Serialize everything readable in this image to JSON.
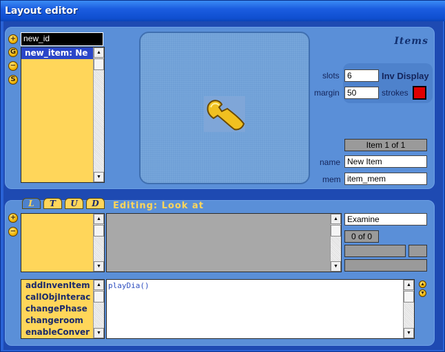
{
  "window": {
    "title": "Layout editor"
  },
  "top_panel": {
    "id_field": "new_id",
    "object_list": [
      "new_item: Ne"
    ],
    "side_buttons": [
      {
        "icon": "plus-icon",
        "glyph": "+"
      },
      {
        "icon": "globe-icon",
        "glyph": "G"
      },
      {
        "icon": "minus-icon",
        "glyph": "−"
      },
      {
        "icon": "s-icon",
        "glyph": "S"
      }
    ],
    "section_title": "Items",
    "slots_label": "slots",
    "slots_value": "6",
    "margin_label": "margin",
    "margin_value": "50",
    "inv_display_label": "Inv Display",
    "strokes_label": "strokes",
    "strokes_color": "#e00000",
    "item_counter": "Item 1 of 1",
    "name_label": "name",
    "name_value": "New Item",
    "mem_label": "mem",
    "mem_value": "item_mem"
  },
  "bottom_panel": {
    "tabs": [
      "L",
      "T",
      "U",
      "D"
    ],
    "active_tab": "L",
    "editing_label": "Editing: Look at",
    "side_buttons": [
      {
        "icon": "plus-icon",
        "glyph": "+"
      },
      {
        "icon": "minus-icon",
        "glyph": "−"
      }
    ],
    "verb_field": "Examine",
    "page_counter": "0 of 0",
    "functions": [
      "addInvenItem",
      "callObjInterac",
      "changePhase",
      "changeroom",
      "enableConver"
    ],
    "code": "playDia()"
  },
  "colors": {
    "accent": "#ffd65a",
    "panel": "#5a8fd8",
    "titlebar": "#1b5de0"
  }
}
